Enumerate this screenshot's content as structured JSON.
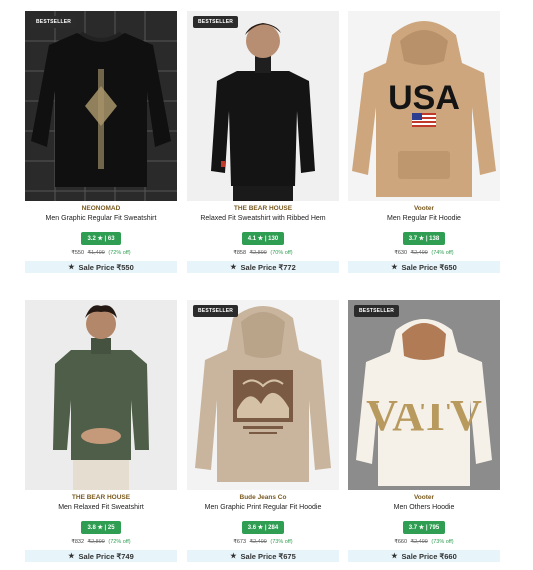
{
  "products": [
    {
      "badge": "BESTSELLER",
      "brand": "NEONOMAD",
      "title": "Men Graphic Regular Fit Sweatshirt",
      "rating": "3.2 ★ | 63",
      "price": "₹550",
      "mrp": "₹1,499",
      "discount": "(72% off)",
      "sale_label": "Sale Price ₹550",
      "colors": {
        "bg": "#2c2c2c",
        "garment": "#111111"
      }
    },
    {
      "badge": "BESTSELLER",
      "brand": "THE BEAR HOUSE",
      "title": "Relaxed Fit Sweatshirt with Ribbed Hem",
      "rating": "4.1 ★ | 130",
      "price": "₹858",
      "mrp": "₹2,899",
      "discount": "(70% off)",
      "sale_label": "Sale Price ₹772",
      "colors": {
        "bg": "#f1f1f1",
        "garment": "#151515"
      }
    },
    {
      "badge": "",
      "brand": "Vooter",
      "title": "Men Regular Fit Hoodie",
      "rating": "3.7 ★ | 138",
      "price": "₹630",
      "mrp": "₹2,499",
      "discount": "(74% off)",
      "sale_label": "Sale Price ₹650",
      "graphic_text": "USA",
      "colors": {
        "bg": "#f4f4f4",
        "garment": "#cfa881"
      }
    },
    {
      "badge": "",
      "brand": "THE BEAR HOUSE",
      "title": "Men Relaxed Fit Sweatshirt",
      "rating": "3.8 ★ | 25",
      "price": "₹832",
      "mrp": "₹2,899",
      "discount": "(72% off)",
      "sale_label": "Sale Price ₹749",
      "colors": {
        "bg": "#ececec",
        "garment": "#4f5e48"
      }
    },
    {
      "badge": "BESTSELLER",
      "brand": "Bude Jeans Co",
      "title": "Men Graphic Print Regular Fit Hoodie",
      "rating": "3.6 ★ | 284",
      "price": "₹673",
      "mrp": "₹2,499",
      "discount": "(73% off)",
      "sale_label": "Sale Price ₹675",
      "colors": {
        "bg": "#f3f3f3",
        "garment": "#c9b59d"
      }
    },
    {
      "badge": "BESTSELLER",
      "brand": "Vooter",
      "title": "Men Others Hoodie",
      "rating": "3.7 ★ | 795",
      "price": "₹660",
      "mrp": "₹2,499",
      "discount": "(73% off)",
      "sale_label": "Sale Price ₹660",
      "graphic_text": "VATV",
      "colors": {
        "bg": "#8a8a8a",
        "garment": "#f6f1e8"
      }
    }
  ]
}
